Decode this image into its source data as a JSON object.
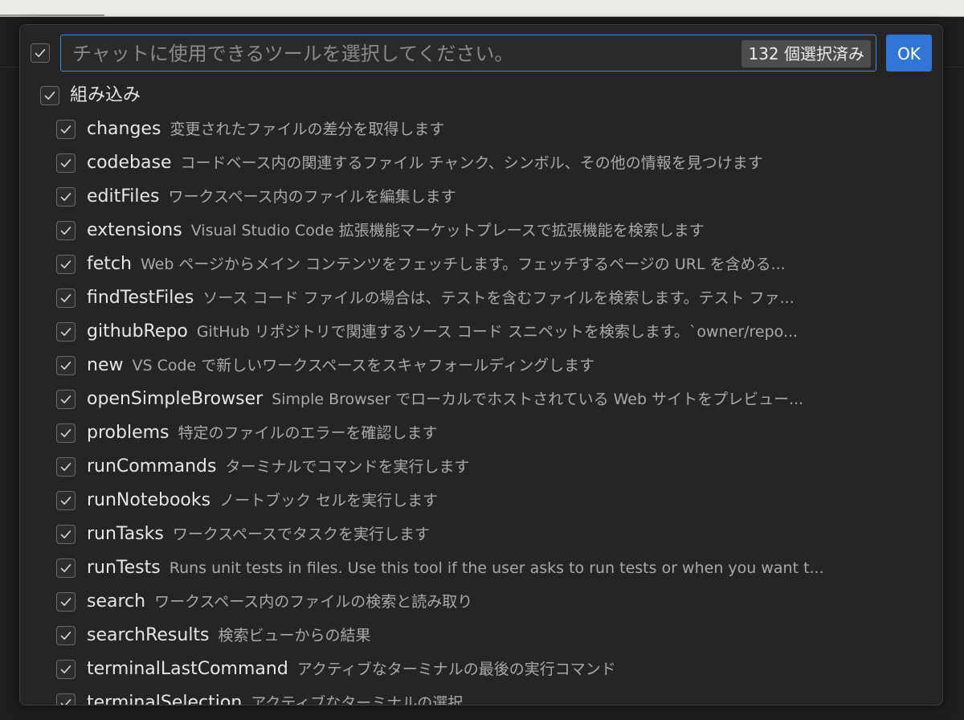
{
  "quick_pick": {
    "placeholder": "チャットに使用できるツールを選択してください。",
    "selected_count": "132 個選択済み",
    "ok_label": "OK",
    "group": {
      "label": "組み込み"
    },
    "tools": [
      {
        "name": "changes",
        "description": "変更されたファイルの差分を取得します",
        "checked": true
      },
      {
        "name": "codebase",
        "description": "コードベース内の関連するファイル チャンク、シンボル、その他の情報を見つけます",
        "checked": true
      },
      {
        "name": "editFiles",
        "description": "ワークスペース内のファイルを編集します",
        "checked": true
      },
      {
        "name": "extensions",
        "description": "Visual Studio Code 拡張機能マーケットプレースで拡張機能を検索します",
        "checked": true
      },
      {
        "name": "fetch",
        "description": "Web ページからメイン コンテンツをフェッチします。フェッチするページの URL を含める...",
        "checked": true
      },
      {
        "name": "findTestFiles",
        "description": "ソース コード ファイルの場合は、テストを含むファイルを検索します。テスト ファ...",
        "checked": true
      },
      {
        "name": "githubRepo",
        "description": "GitHub リポジトリで関連するソース コード スニペットを検索します。`owner/repo...",
        "checked": true
      },
      {
        "name": "new",
        "description": "VS Code で新しいワークスペースをスキャフォールディングします",
        "checked": true
      },
      {
        "name": "openSimpleBrowser",
        "description": "Simple Browser でローカルでホストされている Web サイトをプレビュー...",
        "checked": true
      },
      {
        "name": "problems",
        "description": "特定のファイルのエラーを確認します",
        "checked": true
      },
      {
        "name": "runCommands",
        "description": "ターミナルでコマンドを実行します",
        "checked": true
      },
      {
        "name": "runNotebooks",
        "description": "ノートブック セルを実行します",
        "checked": true
      },
      {
        "name": "runTasks",
        "description": "ワークスペースでタスクを実行します",
        "checked": true
      },
      {
        "name": "runTests",
        "description": "Runs unit tests in files. Use this tool if the user asks to run tests or when you want t...",
        "checked": true
      },
      {
        "name": "search",
        "description": "ワークスペース内のファイルの検索と読み取り",
        "checked": true
      },
      {
        "name": "searchResults",
        "description": "検索ビューからの結果",
        "checked": true
      },
      {
        "name": "terminalLastCommand",
        "description": "アクティブなターミナルの最後の実行コマンド",
        "checked": true
      },
      {
        "name": "terminalSelection",
        "description": "アクティブなターミナルの選択",
        "checked": true
      }
    ]
  }
}
